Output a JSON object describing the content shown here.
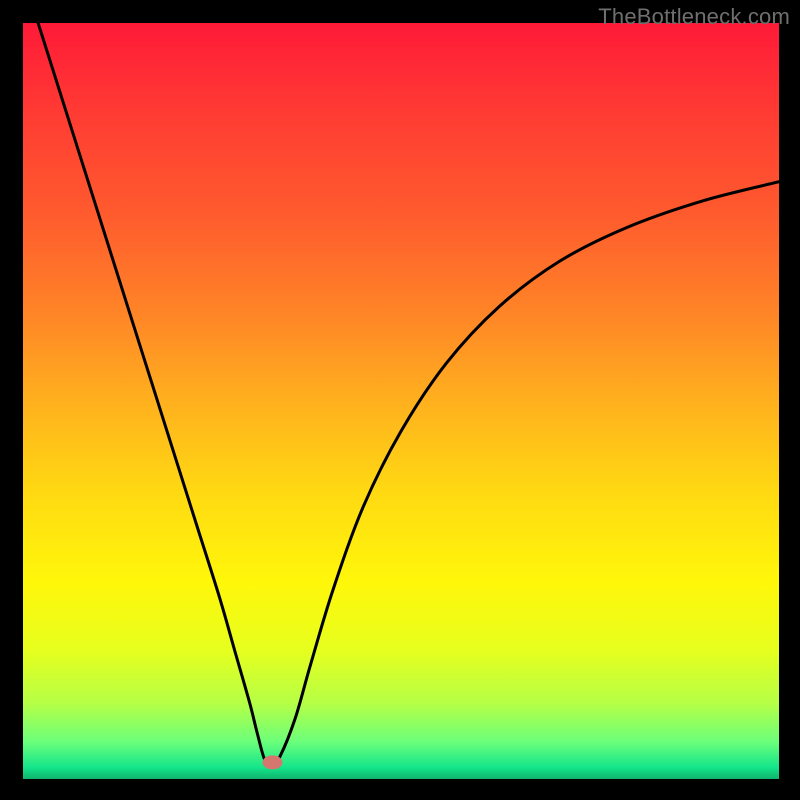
{
  "watermark": "TheBottleneck.com",
  "chart_data": {
    "type": "line",
    "title": "",
    "xlabel": "",
    "ylabel": "",
    "xlim": [
      0,
      100
    ],
    "ylim": [
      0,
      100
    ],
    "grid": false,
    "legend": false,
    "curve": {
      "name": "bottleneck-curve",
      "x": [
        2,
        5,
        8,
        11,
        14,
        17,
        20,
        23,
        26,
        28,
        30,
        31,
        32,
        33,
        34,
        36,
        38,
        41,
        45,
        50,
        56,
        63,
        71,
        80,
        90,
        100
      ],
      "y": [
        100,
        90.5,
        81,
        71.5,
        62,
        52.5,
        43,
        33.5,
        24,
        17,
        10,
        6,
        2.5,
        2,
        3,
        8,
        15,
        25,
        36,
        46,
        55,
        62.5,
        68.5,
        73,
        76.5,
        79
      ]
    },
    "marker": {
      "x": 33,
      "y": 2.2,
      "color": "#d5766f"
    },
    "background_gradient_stops": [
      {
        "offset": 0.0,
        "color": "#ff1a38"
      },
      {
        "offset": 0.12,
        "color": "#ff3b33"
      },
      {
        "offset": 0.25,
        "color": "#ff5a2e"
      },
      {
        "offset": 0.38,
        "color": "#ff8327"
      },
      {
        "offset": 0.5,
        "color": "#ffb01e"
      },
      {
        "offset": 0.62,
        "color": "#ffd912"
      },
      {
        "offset": 0.74,
        "color": "#fff70a"
      },
      {
        "offset": 0.83,
        "color": "#e6ff1e"
      },
      {
        "offset": 0.9,
        "color": "#b5ff46"
      },
      {
        "offset": 0.95,
        "color": "#6dff7a"
      },
      {
        "offset": 0.985,
        "color": "#13e58a"
      },
      {
        "offset": 1.0,
        "color": "#0fb36d"
      }
    ]
  }
}
